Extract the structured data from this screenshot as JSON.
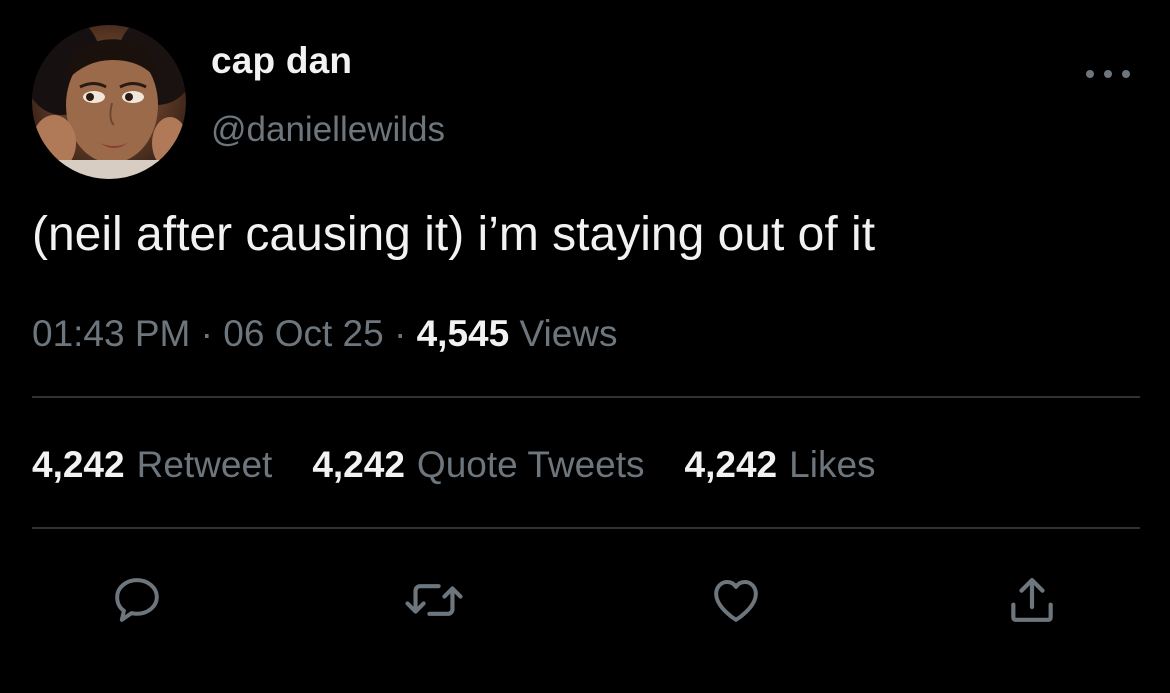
{
  "user": {
    "display_name": "cap dan",
    "handle": "@daniellewilds"
  },
  "tweet": {
    "text": "(neil after causing it) i’m staying out of it"
  },
  "meta": {
    "time": "01:43 PM",
    "separator": "·",
    "date": "06 Oct 25",
    "views_count": "4,545",
    "views_label": "Views"
  },
  "stats": {
    "retweets_count": "4,242",
    "retweets_label": "Retweet",
    "quotes_count": "4,242",
    "quotes_label": "Quote Tweets",
    "likes_count": "4,242",
    "likes_label": "Likes"
  },
  "actions": [
    {
      "icon": "reply-icon"
    },
    {
      "icon": "retweet-icon"
    },
    {
      "icon": "like-icon"
    },
    {
      "icon": "share-icon"
    }
  ],
  "colors": {
    "background": "#000000",
    "primary_text": "#f2f2f2",
    "secondary_text": "#6e767d",
    "divider": "#2f3336"
  }
}
